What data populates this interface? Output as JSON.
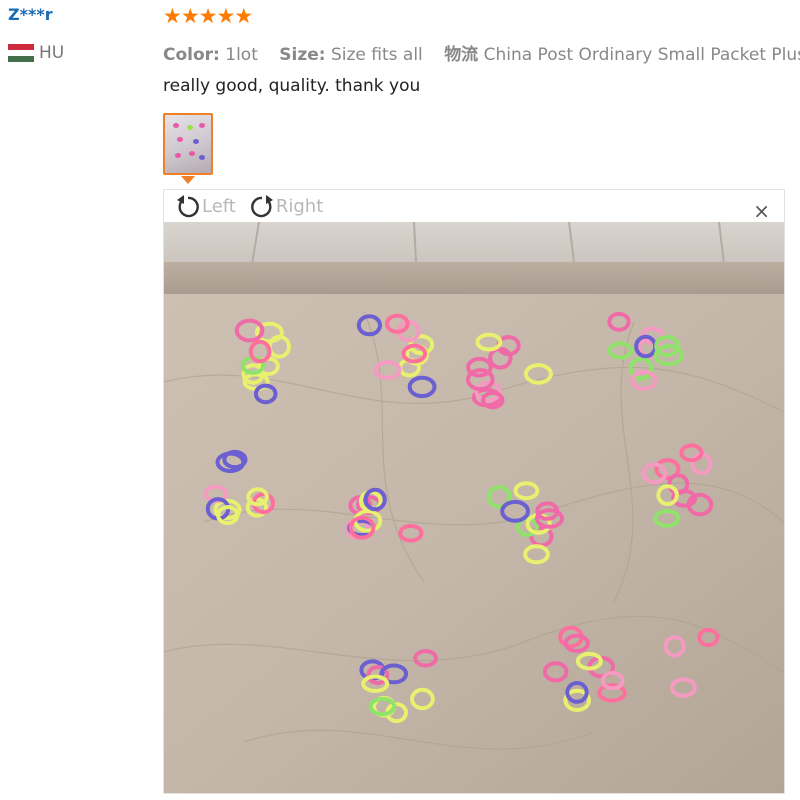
{
  "review": {
    "reviewer_name": "Z***r",
    "country_code": "HU",
    "flag_colors": [
      "#cd2a3e",
      "#ffffff",
      "#436f4d"
    ],
    "rating": 5,
    "star_color": "#ff7a00",
    "color_label": "Color:",
    "color_value": "1lot",
    "size_label": "Size:",
    "size_value": "Size fits all",
    "shipping_label": "物流",
    "shipping_value": "China Post Ordinary Small Packet Plus",
    "text": "really good, quality. thank you"
  },
  "viewer": {
    "rotate_left_label": "Left",
    "rotate_right_label": "Right",
    "close_label": "×",
    "accent_color": "#f07f2a"
  }
}
